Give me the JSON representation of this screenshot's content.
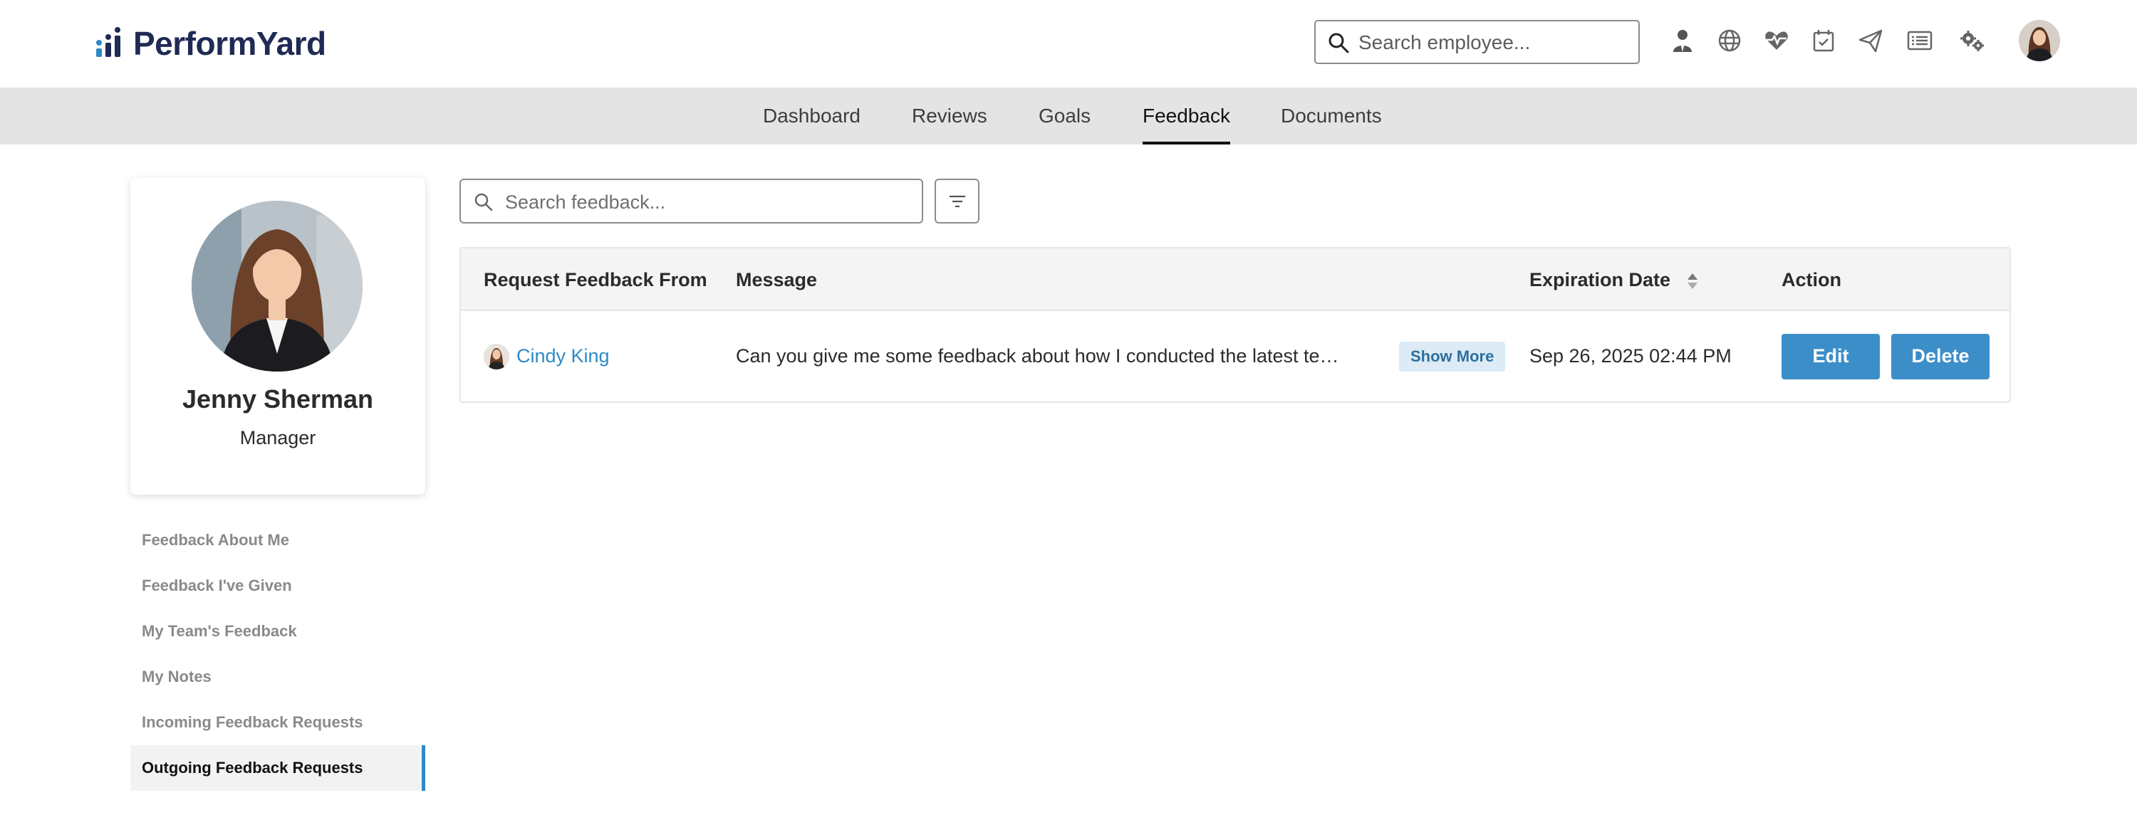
{
  "brand": {
    "name": "PerformYard",
    "logo_color": "#2d8ac6",
    "text_color": "#1f2a55"
  },
  "header": {
    "search": {
      "placeholder": "Search employee..."
    },
    "icons": [
      "person-icon",
      "globe-icon",
      "heart-pulse-icon",
      "calendar-check-icon",
      "paper-plane-icon",
      "list-icon",
      "settings-gears-icon"
    ]
  },
  "nav": {
    "tabs": [
      {
        "label": "Dashboard",
        "active": false
      },
      {
        "label": "Reviews",
        "active": false
      },
      {
        "label": "Goals",
        "active": false
      },
      {
        "label": "Feedback",
        "active": true
      },
      {
        "label": "Documents",
        "active": false
      }
    ]
  },
  "profile": {
    "name": "Jenny Sherman",
    "role": "Manager"
  },
  "sidebar": {
    "items": [
      {
        "label": "Feedback About Me",
        "active": false
      },
      {
        "label": "Feedback I've Given",
        "active": false
      },
      {
        "label": "My Team's Feedback",
        "active": false
      },
      {
        "label": "My Notes",
        "active": false
      },
      {
        "label": "Incoming Feedback Requests",
        "active": false
      },
      {
        "label": "Outgoing Feedback Requests",
        "active": true
      }
    ],
    "accent": "#2d8ac6"
  },
  "main": {
    "search": {
      "placeholder": "Search feedback..."
    },
    "table": {
      "columns": {
        "from": "Request Feedback From",
        "message": "Message",
        "expiration": "Expiration Date",
        "action": "Action"
      },
      "rows": [
        {
          "from": "Cindy King",
          "message": "Can you give me some feedback about how I conducted the latest team…",
          "show_more": "Show More",
          "expiration": "Sep 26, 2025 02:44 PM",
          "edit": "Edit",
          "delete": "Delete"
        }
      ]
    },
    "button_color": "#3c8ec9"
  }
}
